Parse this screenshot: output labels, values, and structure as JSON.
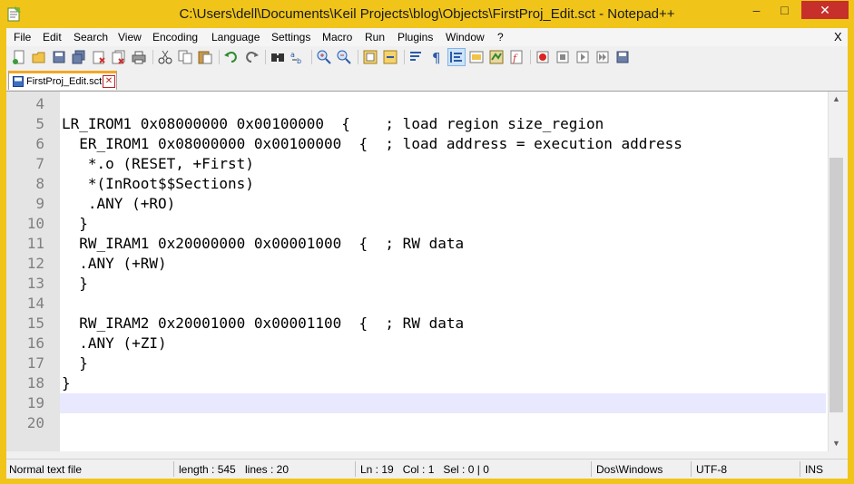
{
  "window": {
    "title": "C:\\Users\\dell\\Documents\\Keil Projects\\blog\\Objects\\FirstProj_Edit.sct - Notepad++",
    "minimize_glyph": "–",
    "maximize_glyph": "□",
    "close_glyph": "✕"
  },
  "menu": {
    "items": [
      "File",
      "Edit",
      "Search",
      "View",
      "Encoding",
      "Language",
      "Settings",
      "Macro",
      "Run",
      "Plugins",
      "Window",
      "?"
    ],
    "close_glyph": "X"
  },
  "toolbar": {
    "icons": [
      "new-file-icon",
      "open-file-icon",
      "save-icon",
      "save-all-icon",
      "close-icon",
      "close-all-icon",
      "print-icon",
      "cut-icon",
      "copy-icon",
      "paste-icon",
      "undo-icon",
      "redo-icon",
      "find-icon",
      "replace-icon",
      "zoom-in-icon",
      "zoom-out-icon",
      "sync-vertical-icon",
      "sync-horizontal-icon",
      "word-wrap-icon",
      "show-all-chars-icon",
      "indent-guide-icon",
      "user-lang-icon",
      "doc-map-icon",
      "function-list-icon",
      "record-macro-icon",
      "stop-macro-icon",
      "play-macro-icon",
      "run-macro-multiple-icon",
      "save-macro-icon"
    ]
  },
  "tab": {
    "label": "FirstProj_Edit.sct",
    "close_glyph": "✕"
  },
  "editor": {
    "lines": [
      {
        "num": "4",
        "text": ""
      },
      {
        "num": "5",
        "text": "LR_IROM1 0x08000000 0x00100000  {    ; load region size_region"
      },
      {
        "num": "6",
        "text": "  ER_IROM1 0x08000000 0x00100000  {  ; load address = execution address"
      },
      {
        "num": "7",
        "text": "   *.o (RESET, +First)"
      },
      {
        "num": "8",
        "text": "   *(InRoot$$Sections)"
      },
      {
        "num": "9",
        "text": "   .ANY (+RO)"
      },
      {
        "num": "10",
        "text": "  }"
      },
      {
        "num": "11",
        "text": "  RW_IRAM1 0x20000000 0x00001000  {  ; RW data"
      },
      {
        "num": "12",
        "text": "  .ANY (+RW)"
      },
      {
        "num": "13",
        "text": "  }"
      },
      {
        "num": "14",
        "text": ""
      },
      {
        "num": "15",
        "text": "  RW_IRAM2 0x20001000 0x00001100  {  ; RW data"
      },
      {
        "num": "16",
        "text": "  .ANY (+ZI)"
      },
      {
        "num": "17",
        "text": "  }"
      },
      {
        "num": "18",
        "text": "}"
      },
      {
        "num": "19",
        "text": ""
      },
      {
        "num": "20",
        "text": ""
      }
    ],
    "current_line": "19"
  },
  "scrollbar": {
    "up_glyph": "▲",
    "down_glyph": "▼"
  },
  "status": {
    "file_type": "Normal text file",
    "length": "length : 545",
    "lines": "lines : 20",
    "position": "Ln : 19   Col : 1   Sel : 0 | 0",
    "eol": "Dos\\Windows",
    "encoding": "UTF-8",
    "mode": "INS"
  },
  "colors": {
    "title_bar": "#f0c419",
    "current_line": "#e8e8ff",
    "gutter": "#e4e4e4",
    "tab_accent": "#f5a623"
  }
}
